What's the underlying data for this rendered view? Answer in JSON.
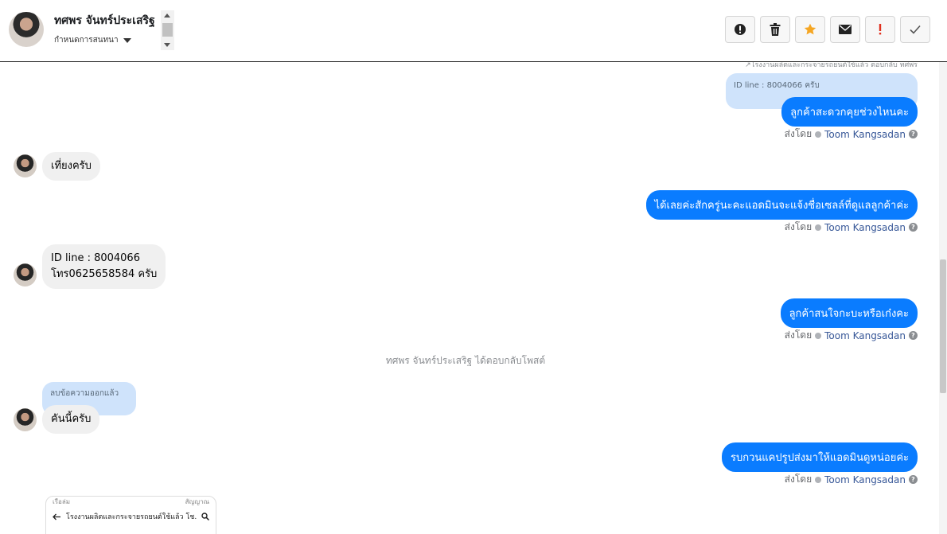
{
  "header": {
    "name": "ทศพร จันทร์ประเสริฐ",
    "subtitle": "กำหนดการสนทนา",
    "actions": [
      {
        "name": "alert-circle-icon"
      },
      {
        "name": "trash-icon"
      },
      {
        "name": "star-icon",
        "color": "#f5a623"
      },
      {
        "name": "envelope-icon"
      },
      {
        "name": "exclamation-icon",
        "color": "#e0301e"
      },
      {
        "name": "check-icon"
      }
    ]
  },
  "chat": {
    "top_cutoff": "↗โรงงานผลิตและกระจายรถยนต์ใช้แล้ว ตอบกลับ ทศพร",
    "sent_prefix": "ส่งโดย",
    "agent": "Toom Kangsadan",
    "messages": [
      {
        "reply_quote": "ID line : 8004066 ครับ",
        "text": "ลูกค้าสะดวกคุยช่วงไหนคะ"
      },
      {
        "in_text": "เที่ยงครับ"
      },
      {
        "text": "ได้เลยค่ะสักครู่นะคะแอดมินจะแจ้งชื่อเซลล์ที่ดูแลลูกค้าค่ะ"
      },
      {
        "in_line1": "ID line : 8004066",
        "in_line2": "โทร0625658584 ครับ"
      },
      {
        "text": "ลูกค้าสนใจกะบะหรือเก๋งคะ"
      },
      {
        "system": "ทศพร จันทร์ประเสริฐ ได้ตอบกลับโพสต์"
      },
      {
        "reply_quote": "ลบข้อความออกแล้ว",
        "in_text": "คันนี้ครับ"
      },
      {
        "text": "รบกวนแคปรูปส่งมาให้แอดมินดูหน่อยค่ะ"
      }
    ],
    "attachment": {
      "status_left": "เรือล่ม",
      "status_right": "สัญญาณ",
      "title": "โรงงานผลิตและกระจายรถยนต์ใช้แล้ว โช..."
    }
  }
}
